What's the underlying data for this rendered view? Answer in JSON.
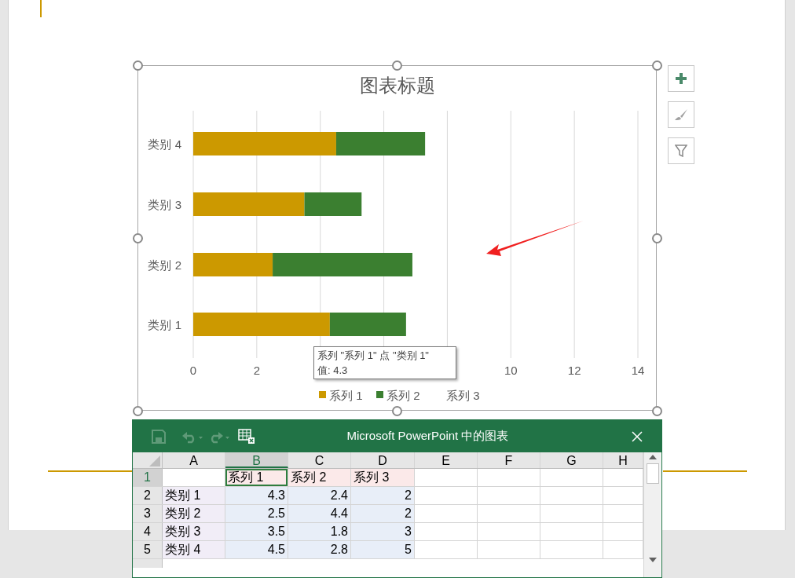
{
  "chart": {
    "title": "图表标题",
    "chart_data": {
      "type": "bar",
      "orientation": "horizontal",
      "stacked": true,
      "grid": true,
      "legend": "bottom",
      "categories": [
        "类别 4",
        "类别 3",
        "类别 2",
        "类别 1"
      ],
      "series": [
        {
          "name": "系列 1",
          "color": "#cc9900",
          "values": [
            4.5,
            3.5,
            2.5,
            4.3
          ]
        },
        {
          "name": "系列 2",
          "color": "#3b7f30",
          "values": [
            2.8,
            1.8,
            4.4,
            2.4
          ]
        }
      ],
      "xlim": [
        0,
        14
      ],
      "xticks": [
        0,
        2,
        10,
        12,
        14
      ]
    },
    "legend_extra_label": "系列 3",
    "tooltip": [
      "系列 \"系列 1\" 点 \"类别 1\"",
      "值: 4.3"
    ]
  },
  "data_window": {
    "title": "Microsoft PowerPoint 中的图表",
    "columns": [
      {
        "label": "A",
        "selected": false
      },
      {
        "label": "B",
        "selected": true
      },
      {
        "label": "C",
        "selected": false
      },
      {
        "label": "D",
        "selected": false
      },
      {
        "label": "E",
        "selected": false
      },
      {
        "label": "F",
        "selected": false
      },
      {
        "label": "G",
        "selected": false
      },
      {
        "label": "H",
        "selected": false
      }
    ],
    "rows": [
      {
        "label": "1",
        "selected": true,
        "cells": [
          null,
          "系列 1",
          "系列 2",
          "系列 3"
        ]
      },
      {
        "label": "2",
        "selected": false,
        "cells": [
          "类别 1",
          "4.3",
          "2.4",
          "2"
        ]
      },
      {
        "label": "3",
        "selected": false,
        "cells": [
          "类别 2",
          "2.5",
          "4.4",
          "2"
        ]
      },
      {
        "label": "4",
        "selected": false,
        "cells": [
          "类别 3",
          "3.5",
          "1.8",
          "3"
        ]
      },
      {
        "label": "5",
        "selected": false,
        "cells": [
          "类别 4",
          "4.5",
          "2.8",
          "5"
        ]
      }
    ]
  }
}
